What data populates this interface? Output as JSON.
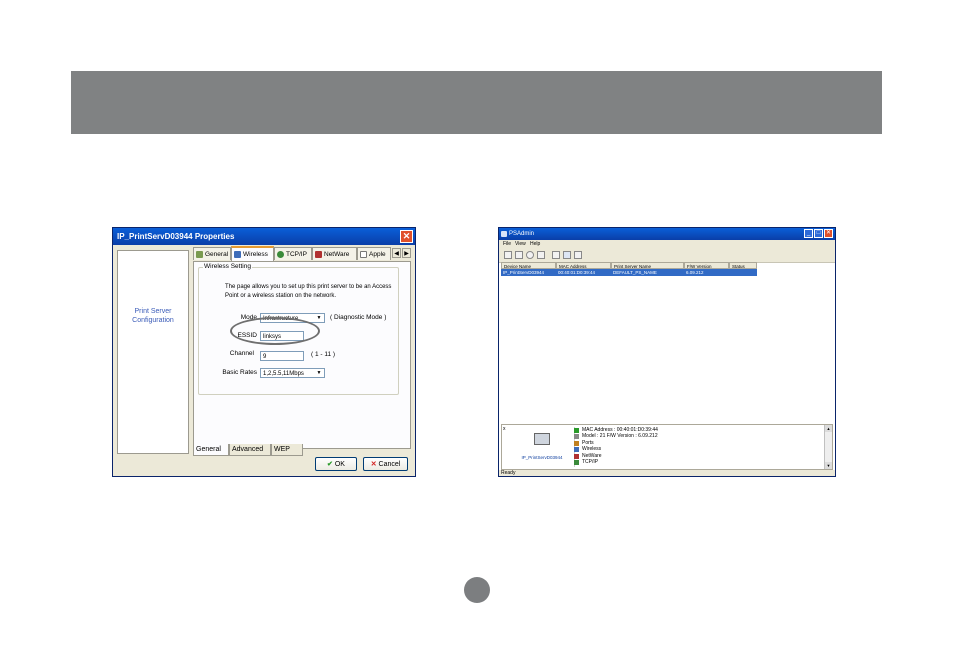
{
  "properties_dialog": {
    "title": "IP_PrintServD03944 Properties",
    "close_glyph": "✕",
    "left_panel_label": "Print Server Configuration",
    "tabs": [
      {
        "label": "General",
        "icon": "general-icon",
        "active": false
      },
      {
        "label": "Wireless",
        "icon": "wireless-icon",
        "active": true
      },
      {
        "label": "TCP/IP",
        "icon": "tcpip-icon",
        "active": false
      },
      {
        "label": "NetWare",
        "icon": "netware-icon",
        "active": false
      },
      {
        "label": "Apple",
        "icon": "apple-icon",
        "active": false
      }
    ],
    "tab_scroll": {
      "left": "◀",
      "right": "▶"
    },
    "group_label": "Wireless Setting",
    "description": "The page allows you to set up this print server to be an Access Point or a wireless station on the network.",
    "mode": {
      "label": "Mode",
      "value": "Infrastructure",
      "hint": "( Diagnostic Mode )"
    },
    "essid": {
      "label": "ESSID",
      "value": "linksys"
    },
    "channel": {
      "label": "Channel",
      "value": "9",
      "hint": "( 1 - 11 )"
    },
    "basic_rates": {
      "label": "Basic Rates",
      "value": "1,2,5.5,11Mbps"
    },
    "dropdown_glyph": "▼",
    "bottom_tabs": [
      "General",
      "Advanced",
      "WEP"
    ],
    "ok_label": "OK",
    "ok_glyph": "✔",
    "cancel_label": "Cancel",
    "cancel_glyph": "✕"
  },
  "psadmin_window": {
    "title": "PSAdmin",
    "window_buttons": {
      "minimize": "_",
      "maximize": "□",
      "close": "✕"
    },
    "menu": [
      "File",
      "View",
      "Help"
    ],
    "columns": [
      "Device Name",
      "MAC Address",
      "Print Server Name",
      "F/W Version",
      "Status"
    ],
    "selected_row": {
      "device_name": "IP_PrintServD03944",
      "mac_address": "00:40:01:D0:39:44",
      "print_server_name": "DEFAULT_PS_NAME",
      "fw_version": "6.09.212",
      "status": ""
    },
    "detail": {
      "device_label": "IP_PrintServD03944",
      "collapse_glyph": "x",
      "tree": [
        "MAC Address : 00:40:01:D0:39:44",
        "Model : 21   F/W Version : 6.09.212",
        "Ports",
        "Wireless",
        "NetWare",
        "TCP/IP"
      ],
      "scroll_up": "▲",
      "scroll_down": "▼"
    },
    "status_bar": "Ready"
  },
  "colors": {
    "header_band": "#808283",
    "title_bar": "#0a4fc8",
    "selection": "#316ac5",
    "link_text": "#3a5bb8"
  }
}
